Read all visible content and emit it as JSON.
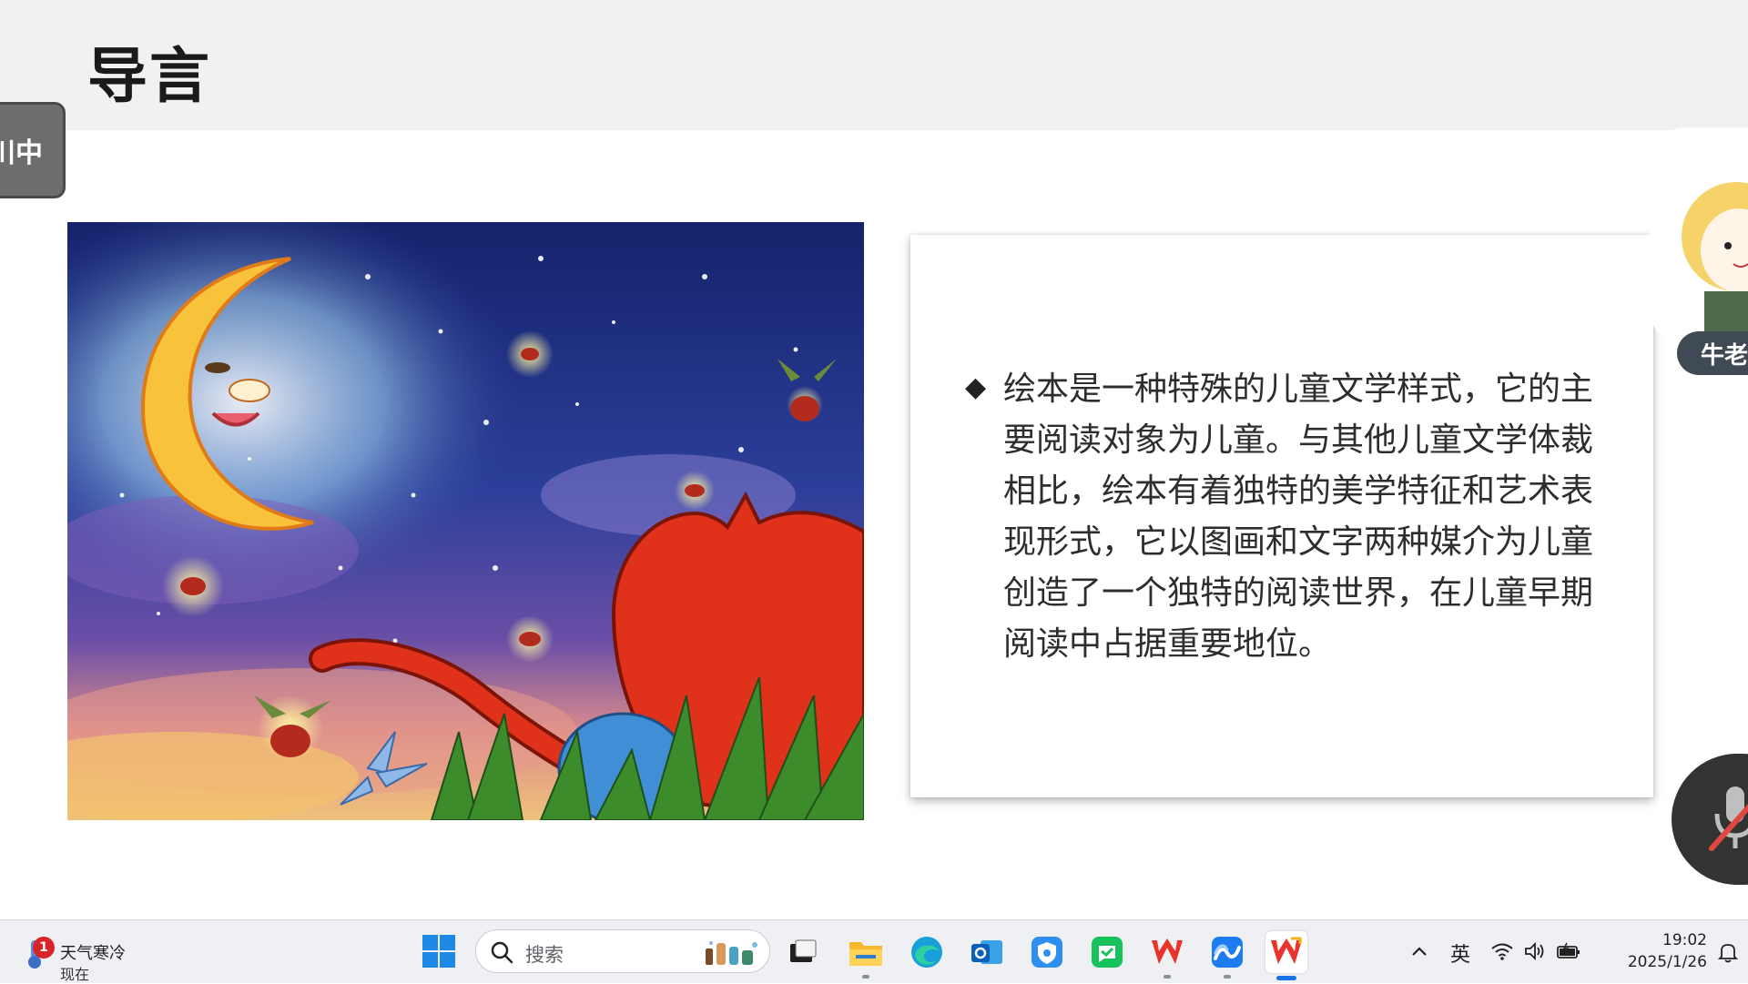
{
  "slide": {
    "title": "导言",
    "side_tab_label": "川中",
    "bullet_symbol": "◆",
    "body_text": "绘本是一种特殊的儿童文学样式，它的主要阅读对象为儿童。与其他儿童文学体裁相比，绘本有着独特的美学特征和艺术表现形式，它以图画和文字两种媒介为儿童创造了一个独特的阅读世界，在儿童早期阅读中占据重要地位。"
  },
  "meeting": {
    "participant_name": "牛老",
    "mic_state": "muted"
  },
  "taskbar": {
    "weather": {
      "badge_count": "1",
      "label": "天气寒冷",
      "sub_label": "现在"
    },
    "search": {
      "placeholder": "搜索"
    },
    "apps": [
      {
        "name": "task-view",
        "running": false
      },
      {
        "name": "file-explorer",
        "running": true
      },
      {
        "name": "edge",
        "running": false
      },
      {
        "name": "outlook",
        "running": false
      },
      {
        "name": "security-app",
        "running": false
      },
      {
        "name": "wechat-work",
        "running": false
      },
      {
        "name": "wps-office",
        "running": true
      },
      {
        "name": "tencent-meeting",
        "running": true
      },
      {
        "name": "wps-presentation",
        "running": true,
        "active": true
      }
    ],
    "tray": {
      "ime": "英",
      "time": "19:02",
      "date": "2025/1/26"
    }
  },
  "colors": {
    "header_bg": "#f1f1f2",
    "taskbar_bg": "#eef0f4",
    "text_dark": "#2d2d2d",
    "accent_blue": "#1a73e8"
  }
}
